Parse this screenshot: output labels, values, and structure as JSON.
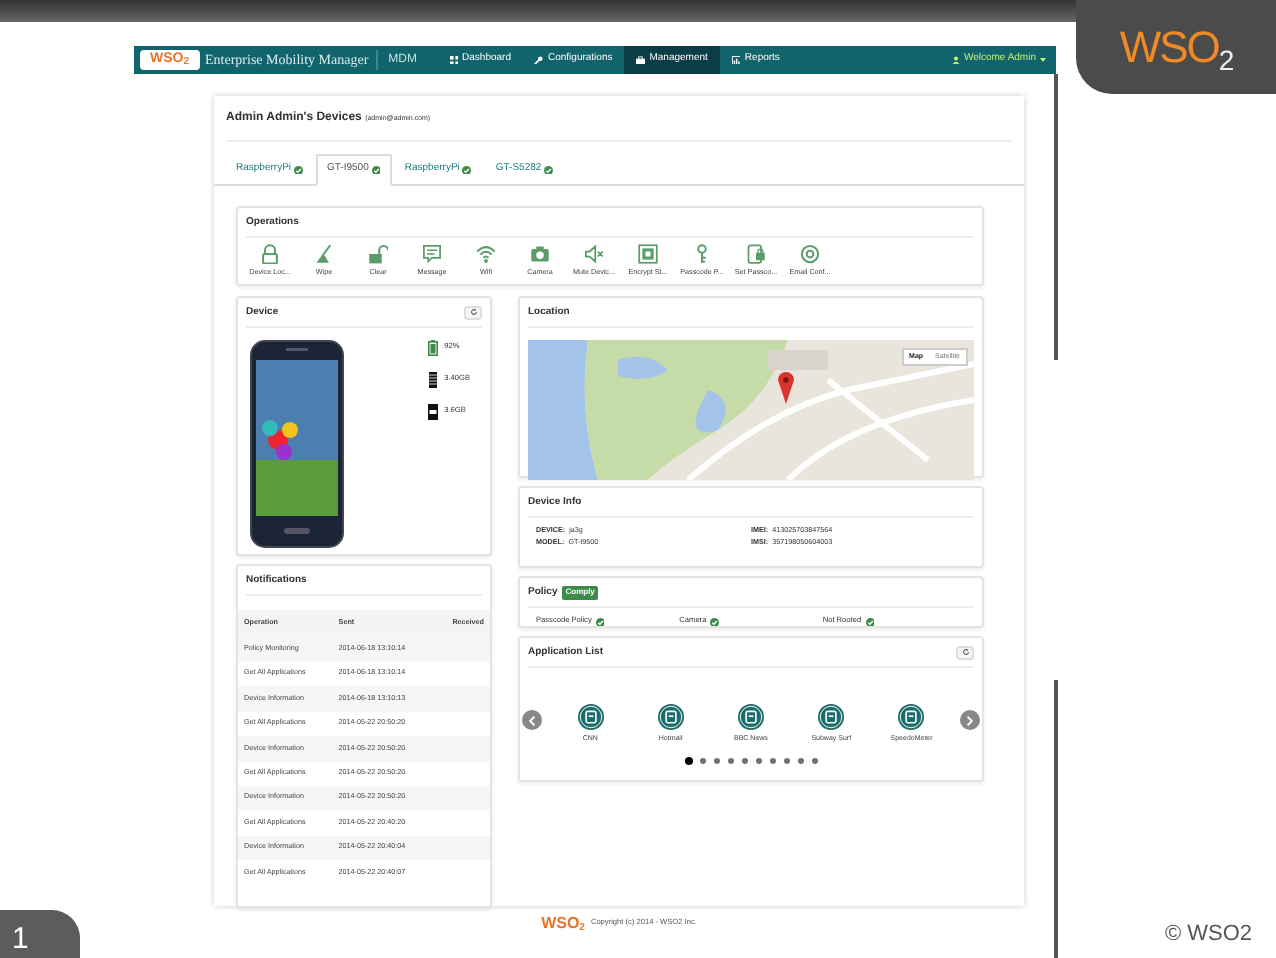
{
  "slide": {
    "logo": "WSO$_{2}$",
    "page_number": "1",
    "copyright": "© WSO2"
  },
  "navbar": {
    "logo": "WSO$_{2}$",
    "brand": "Enterprise Mobility Manager",
    "product": "MDM",
    "items": [
      {
        "label": "Dashboard",
        "selected": false
      },
      {
        "label": "Configurations",
        "selected": false
      },
      {
        "label": "Management",
        "selected": true
      },
      {
        "label": "Reports",
        "selected": false
      }
    ],
    "user": "Welcome Admin"
  },
  "page": {
    "title": "Admin Admin's Devices",
    "email": "(admin@admin.com)",
    "device_tabs": [
      {
        "label": "RaspberryPi",
        "selected": false
      },
      {
        "label": "GT-I9500",
        "selected": true
      },
      {
        "label": "RaspberryPi",
        "selected": false
      },
      {
        "label": "GT-S5282",
        "selected": false
      }
    ]
  },
  "operations": {
    "title": "Operations",
    "items": [
      "Device Loc...",
      "Wipe",
      "Clear",
      "Message",
      "Wifi",
      "Camera",
      "Mute Devic...",
      "Encrypt St...",
      "Passcode P...",
      "Set Passco...",
      "Email Conf..."
    ]
  },
  "device": {
    "title": "Device",
    "stats": [
      "92%",
      "3.40GB",
      "3.6GB"
    ]
  },
  "notifications": {
    "title": "Notifications",
    "columns": [
      "Operation",
      "Sent",
      "Received"
    ],
    "rows": [
      [
        "Policy Monitoring",
        "2014-06-18 13:10:14"
      ],
      [
        "Get All Applications",
        "2014-06-18 13:10:14"
      ],
      [
        "Device Information",
        "2014-06-18 13:10:13"
      ],
      [
        "Get All Applications",
        "2014-05-22 20:50:20"
      ],
      [
        "Device Information",
        "2014-05-22 20:50:20"
      ],
      [
        "Get All Applications",
        "2014-05-22 20:50:20"
      ],
      [
        "Device Information",
        "2014-05-22 20:50:20"
      ],
      [
        "Get All Applications",
        "2014-05-22 20:40:20"
      ],
      [
        "Device Information",
        "2014-05-22 20:40:04"
      ],
      [
        "Get All Applications",
        "2014-05-22 20:40:07"
      ]
    ]
  },
  "location": {
    "title": "Location",
    "map_types": [
      {
        "label": "Map",
        "selected": true
      },
      {
        "label": "Satellite",
        "selected": false
      }
    ]
  },
  "device_info": {
    "title": "Device Info",
    "fields": [
      {
        "label": "DEVICE:",
        "value": "ja3g"
      },
      {
        "label": "MODEL:",
        "value": "GT-I9500"
      },
      {
        "label": "IMEI:",
        "value": "413025703847564"
      },
      {
        "label": "IMSI:",
        "value": "357198050604003"
      }
    ]
  },
  "policy": {
    "title": "Policy",
    "status": "Comply",
    "items": [
      "Passcode Policy",
      "Camera",
      "Not Rooted"
    ]
  },
  "app_list": {
    "title": "Application List",
    "apps": [
      "CNN",
      "Hotmail",
      "BBC News",
      "Subway Surf",
      "SpeedoMeter"
    ],
    "pages": [
      {
        "selected": true
      },
      {
        "selected": false
      },
      {
        "selected": false
      },
      {
        "selected": false
      },
      {
        "selected": false
      },
      {
        "selected": false
      },
      {
        "selected": false
      },
      {
        "selected": false
      },
      {
        "selected": false
      },
      {
        "selected": false
      }
    ]
  },
  "footer": {
    "logo": "WSO$_{2}$",
    "copyright": "Copyright (c) 2014 - WSO2 Inc."
  }
}
